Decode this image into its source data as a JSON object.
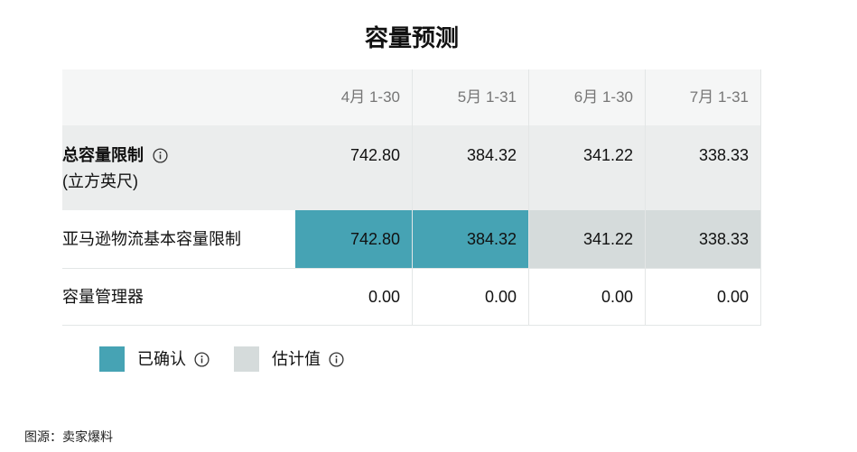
{
  "title": "容量预测",
  "table": {
    "columns": [
      "4月 1-30",
      "5月 1-31",
      "6月 1-30",
      "7月 1-31"
    ],
    "rows": [
      {
        "label": "总容量限制",
        "sublabel": "(立方英尺)",
        "icon": "info-icon",
        "values": [
          "742.80",
          "384.32",
          "341.22",
          "338.33"
        ]
      },
      {
        "label": "亚马逊物流基本容量限制",
        "values": [
          "742.80",
          "384.32",
          "341.22",
          "338.33"
        ],
        "fills": [
          "#46a3b4",
          "#46a3b4",
          "#d5dbdb",
          "#d5dbdb"
        ]
      },
      {
        "label": "容量管理器",
        "values": [
          "0.00",
          "0.00",
          "0.00",
          "0.00"
        ]
      }
    ]
  },
  "legend": [
    {
      "label": "已确认",
      "color": "#46a3b4",
      "icon": "info-icon"
    },
    {
      "label": "估计值",
      "color": "#d5dbdb",
      "icon": "info-icon"
    }
  ],
  "source": "图源：卖家爆料",
  "colors": {
    "header_bg": "#f5f6f6",
    "summary_bg": "#ebeded",
    "border": "#e3e6e6",
    "header_text": "#767676",
    "text": "#111111"
  }
}
